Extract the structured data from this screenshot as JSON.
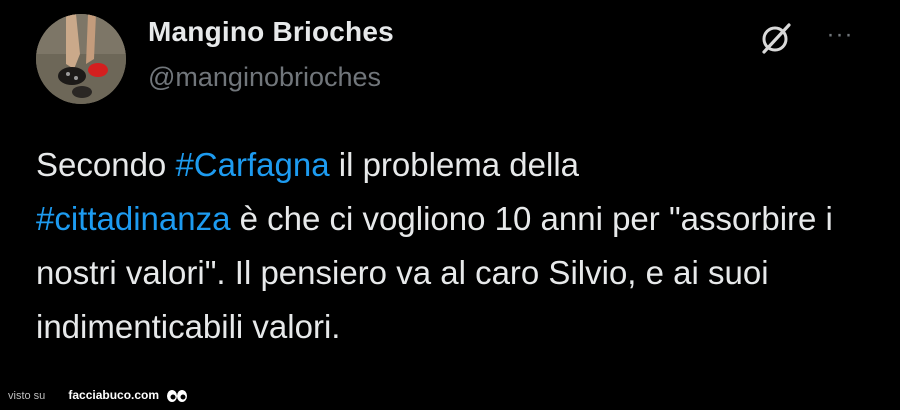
{
  "author": {
    "display_name": "Mangino Brioches",
    "handle": "@manginobrioches",
    "avatar_icon": "avatar-photo"
  },
  "actions": {
    "grok_icon": "grok-icon",
    "more_icon": "more-options-icon",
    "more_label": "···"
  },
  "tweet": {
    "p1": "Secondo ",
    "hashtag1": "#Carfagna",
    "p2": " il problema della",
    "hashtag2": "#cittadinanza",
    "p3": " è che ci vogliono 10 anni per \"assorbire i nostri valori\". Il pensiero va al caro Silvio, e ai suoi indimenticabili valori."
  },
  "colors": {
    "background": "#000000",
    "text": "#e7e9ea",
    "secondary": "#71767b",
    "hashtag": "#1d9bf0"
  },
  "watermark": {
    "prefix": "visto su",
    "site": "facciabuco.com"
  }
}
